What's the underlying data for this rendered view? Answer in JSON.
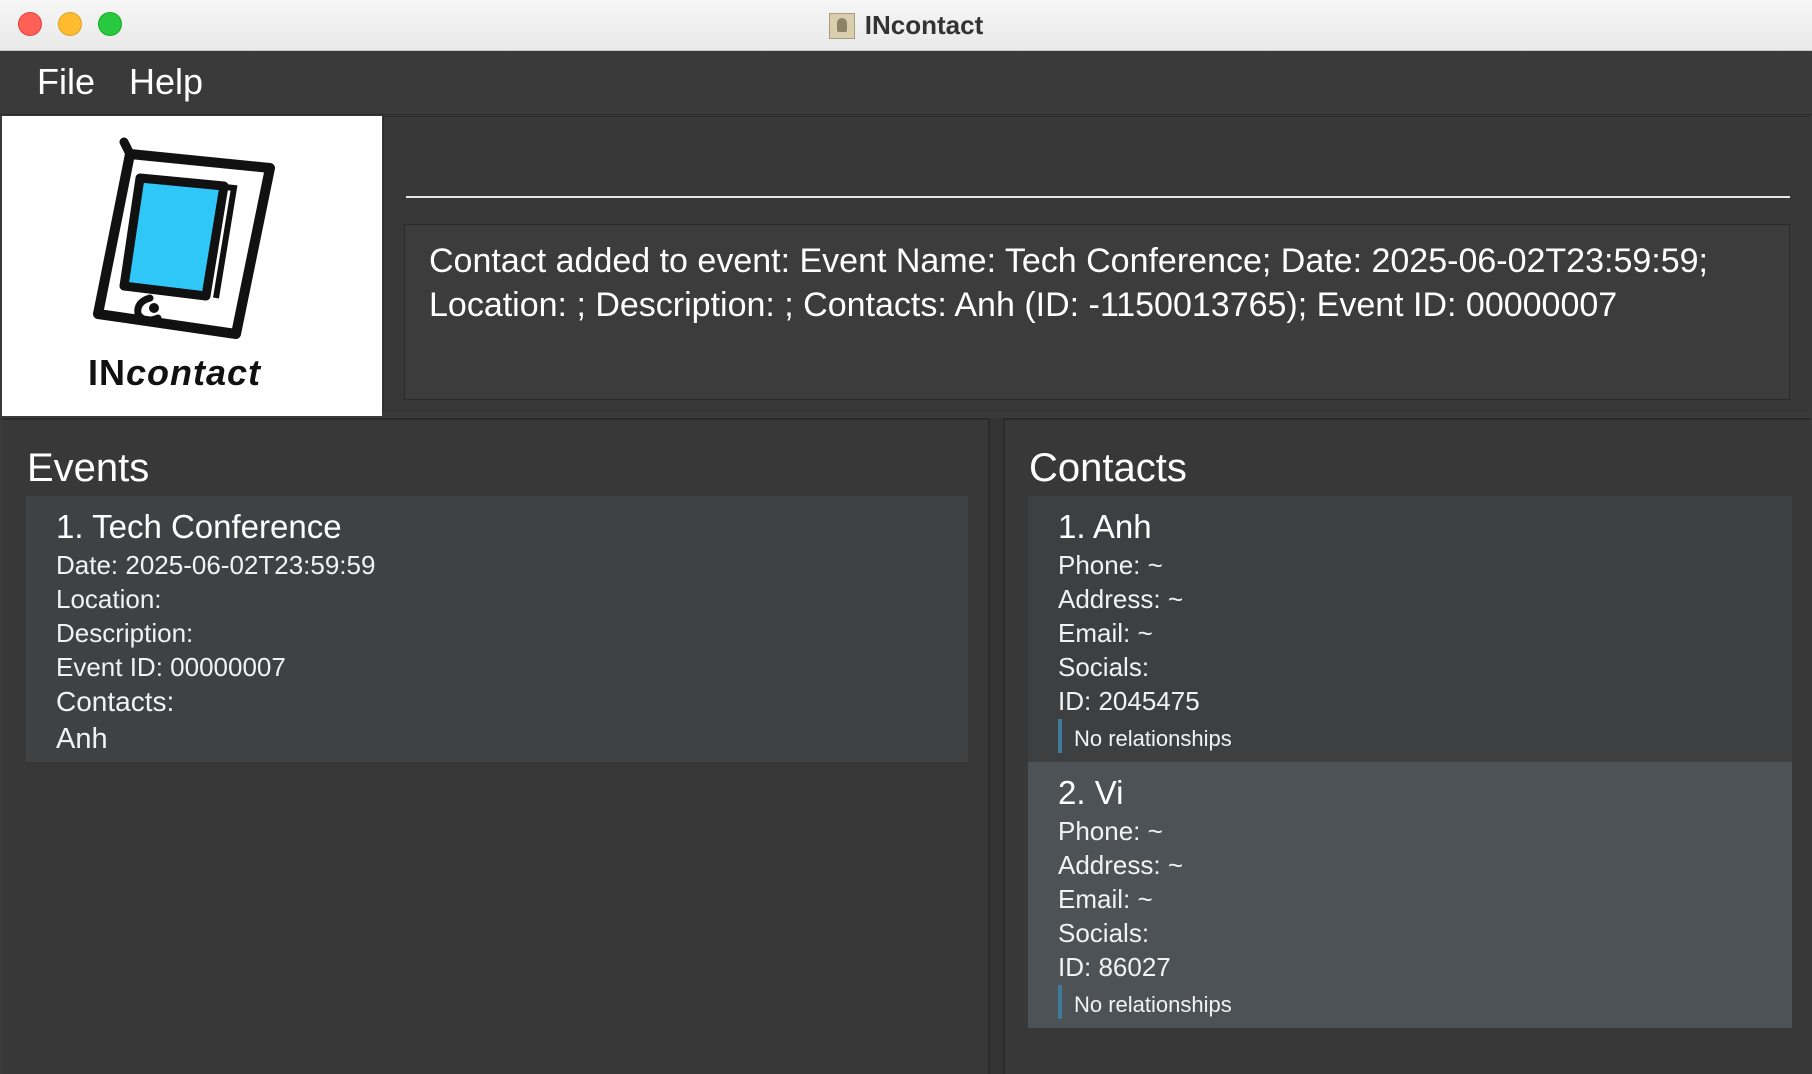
{
  "window": {
    "title": "INcontact"
  },
  "menu": {
    "file": "File",
    "help": "Help"
  },
  "logo": {
    "prefix": "IN",
    "suffix": "contact"
  },
  "command": {
    "value": "",
    "placeholder": ""
  },
  "result": {
    "line1": "Contact added to event: Event Name: Tech Conference; Date: 2025-06-02T23:59:59;",
    "line2": "Location: ; Description: ; Contacts: Anh (ID: -1150013765); Event ID: 00000007"
  },
  "events": {
    "title": "Events",
    "items": [
      {
        "name": "1.  Tech Conference",
        "date": "Date: 2025-06-02T23:59:59",
        "location": "Location:",
        "description": "Description:",
        "event_id": "Event ID: 00000007",
        "contacts_label": "Contacts:",
        "contacts": "Anh"
      }
    ]
  },
  "contacts": {
    "title": "Contacts",
    "items": [
      {
        "name": "1. Anh",
        "phone": "Phone: ~",
        "address": "Address: ~",
        "email": "Email: ~",
        "socials": "Socials:",
        "id": "ID: 2045475",
        "relationships": "No relationships"
      },
      {
        "name": "2. Vi",
        "phone": "Phone: ~",
        "address": "Address: ~",
        "email": "Email: ~",
        "socials": "Socials:",
        "id": "ID: 86027",
        "relationships": "No relationships"
      }
    ]
  },
  "colors": {
    "background": "#3a3a3a",
    "selected_card": "#4d5256",
    "relationship_bar": "#3e7b9b",
    "logo_screen": "#2fc6f8"
  }
}
